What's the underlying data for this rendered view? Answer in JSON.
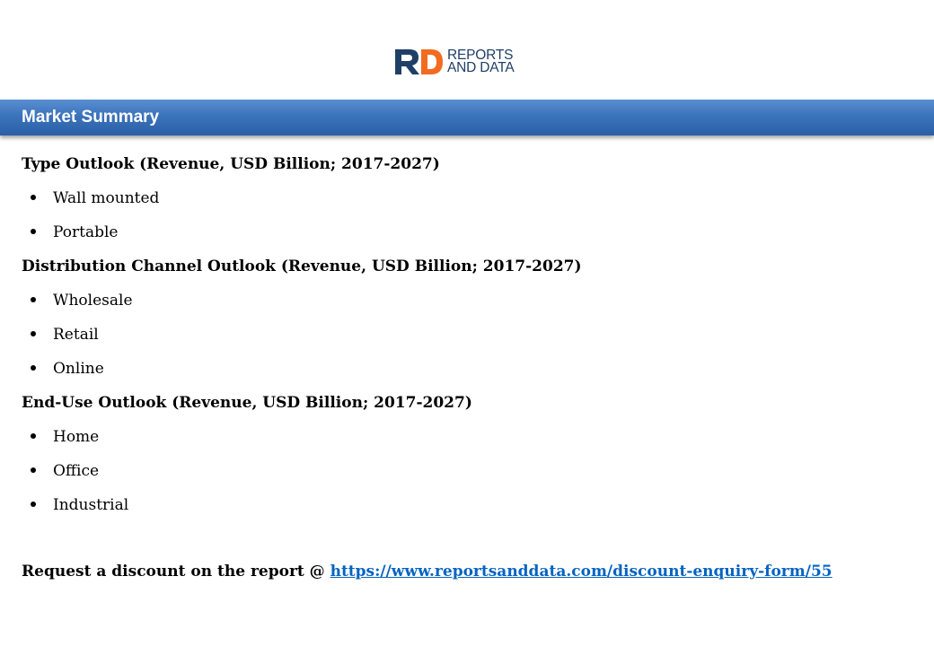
{
  "logo": {
    "line1": "REPORTS",
    "line2": "AND DATA",
    "colors": {
      "navy": "#1f3f66",
      "orange": "#f26b21"
    }
  },
  "banner": {
    "title": "Market Summary",
    "color": "#3b73bb"
  },
  "sections": [
    {
      "heading": "Type Outlook (Revenue, USD Billion; 2017-2027)",
      "items": [
        "Wall mounted",
        "Portable"
      ]
    },
    {
      "heading": "Distribution Channel Outlook (Revenue, USD Billion; 2017-2027)",
      "items": [
        "Wholesale",
        "Retail",
        "Online"
      ]
    },
    {
      "heading": "End-Use Outlook (Revenue, USD Billion; 2017-2027)",
      "items": [
        "Home",
        "Office",
        "Industrial"
      ]
    }
  ],
  "request": {
    "prefix": "Request a discount on the report @ ",
    "link_text": "https://www.reportsanddata.com/discount-enquiry-form/55",
    "link_color": "#0563c1"
  }
}
